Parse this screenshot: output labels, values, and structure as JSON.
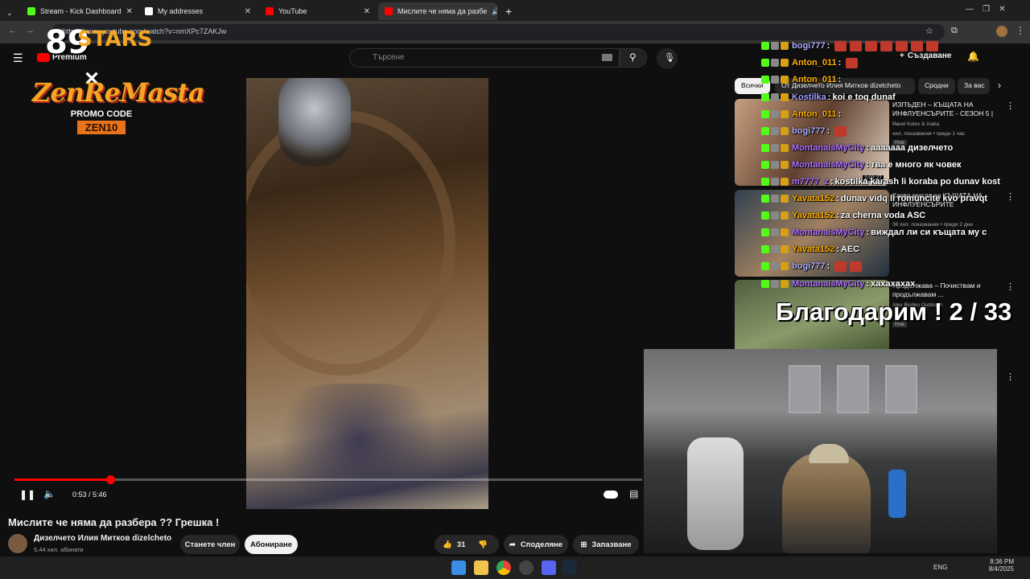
{
  "browser": {
    "tabs": [
      {
        "title": "Stream - Kick Dashboard",
        "favicon_color": "#53fc18"
      },
      {
        "title": "My addresses",
        "favicon_color": "#ffffff"
      },
      {
        "title": "YouTube",
        "favicon_color": "#ff0000"
      },
      {
        "title": "Мислите че няма да разбе",
        "favicon_color": "#ff0000"
      }
    ],
    "url": "https://www.youtube.com/watch?v=nmXPc7ZAKJw"
  },
  "youtube": {
    "logo_text": "Premium",
    "search_placeholder": "Търсене",
    "create_label": "Създаване",
    "chips": [
      "Всички",
      "От Дизелчето Илия Митков dizelcheto",
      "Сродни",
      "За вас"
    ],
    "video": {
      "title": "Мислите че няма да разбера ?? Грешка !",
      "time": "0:53 / 5:46",
      "progress": 0.153
    },
    "channel": {
      "name": "Дизелчето Илия Митков dizelcheto",
      "subscribers": "5,44 хил. абонати"
    },
    "actions": {
      "join": "Станете член",
      "subscribe": "Абониране",
      "likes": "31",
      "share": "Споделяне",
      "save": "Запазване"
    },
    "recommendations": [
      {
        "title": "ИЗПЪДЕН – КЪЩАТА НА ИНФЛУЕНСЪРИТЕ - СЕЗОН 5 | ...",
        "channel": "Pavel Kolev & Inaka",
        "meta": "хил. показвания • преди 1 час",
        "badge": "Нов",
        "duration": "2:02:27"
      },
      {
        "title": "Какво мисля за КЪЩАТА НА ИНФЛУЕНСЪРИТЕ",
        "channel": "",
        "meta": "36 хил. показвания • преди 2 дни",
        "badge": "",
        "duration": ""
      },
      {
        "title": "Продължава – Почиствам и продължавам ...",
        "channel": "Alex Bishko Outdoors",
        "meta": "",
        "badge": "Нов",
        "duration": ""
      }
    ]
  },
  "overlay": {
    "stars_text": "STARS",
    "stars_number": "89",
    "zen_title": "ZenReMasta",
    "promo_label": "PROMO CODE",
    "promo_code": "ZEN10",
    "thanks": "Благодарим ! 2 / 33"
  },
  "chat": [
    {
      "user": "bogi777",
      "msg": "",
      "color": "#b0b0ff",
      "emotes": 7
    },
    {
      "user": "Anton_011",
      "msg": "",
      "color": "#ffb000",
      "emotes": 1
    },
    {
      "user": "Anton_011",
      "msg": "",
      "color": "#ffb000",
      "emotes": 0
    },
    {
      "user": "Kostilka",
      "msg": "koi e toq dunaf",
      "color": "#9fa0ff",
      "emotes": 0
    },
    {
      "user": "Anton_011",
      "msg": "",
      "color": "#ffb000",
      "emotes": 0
    },
    {
      "user": "bogi777",
      "msg": "",
      "color": "#b0b0ff",
      "emotes": 1
    },
    {
      "user": "MontanalsMyCity",
      "msg": "ааааааа дизелчето",
      "color": "#b070ff",
      "emotes": 0
    },
    {
      "user": "MontanalsMyCity",
      "msg": "тва е много як човек",
      "color": "#b070ff",
      "emotes": 0
    },
    {
      "user": "m7777_z",
      "msg": "kostilka karash li koraba po dunav kost",
      "color": "#b070ff",
      "emotes": 0
    },
    {
      "user": "Yavata152",
      "msg": "dunav vidq li romuncite kvo pravqt",
      "color": "#ffb000",
      "emotes": 0
    },
    {
      "user": "Yavata152",
      "msg": "za cherna voda ASC",
      "color": "#ffb000",
      "emotes": 0
    },
    {
      "user": "MontanalsMyCity",
      "msg": "виждал ли си къщата му с",
      "color": "#b070ff",
      "emotes": 0
    },
    {
      "user": "Yavata152",
      "msg": "AEC",
      "color": "#ffb000",
      "emotes": 0
    },
    {
      "user": "bogi777",
      "msg": "",
      "color": "#b0b0ff",
      "emotes": 2
    },
    {
      "user": "MontanalsMyCity",
      "msg": "хахахахах",
      "color": "#b070ff",
      "emotes": 0
    }
  ],
  "taskbar": {
    "language": "ENG",
    "time": "8:36 PM",
    "date": "8/4/2025"
  }
}
